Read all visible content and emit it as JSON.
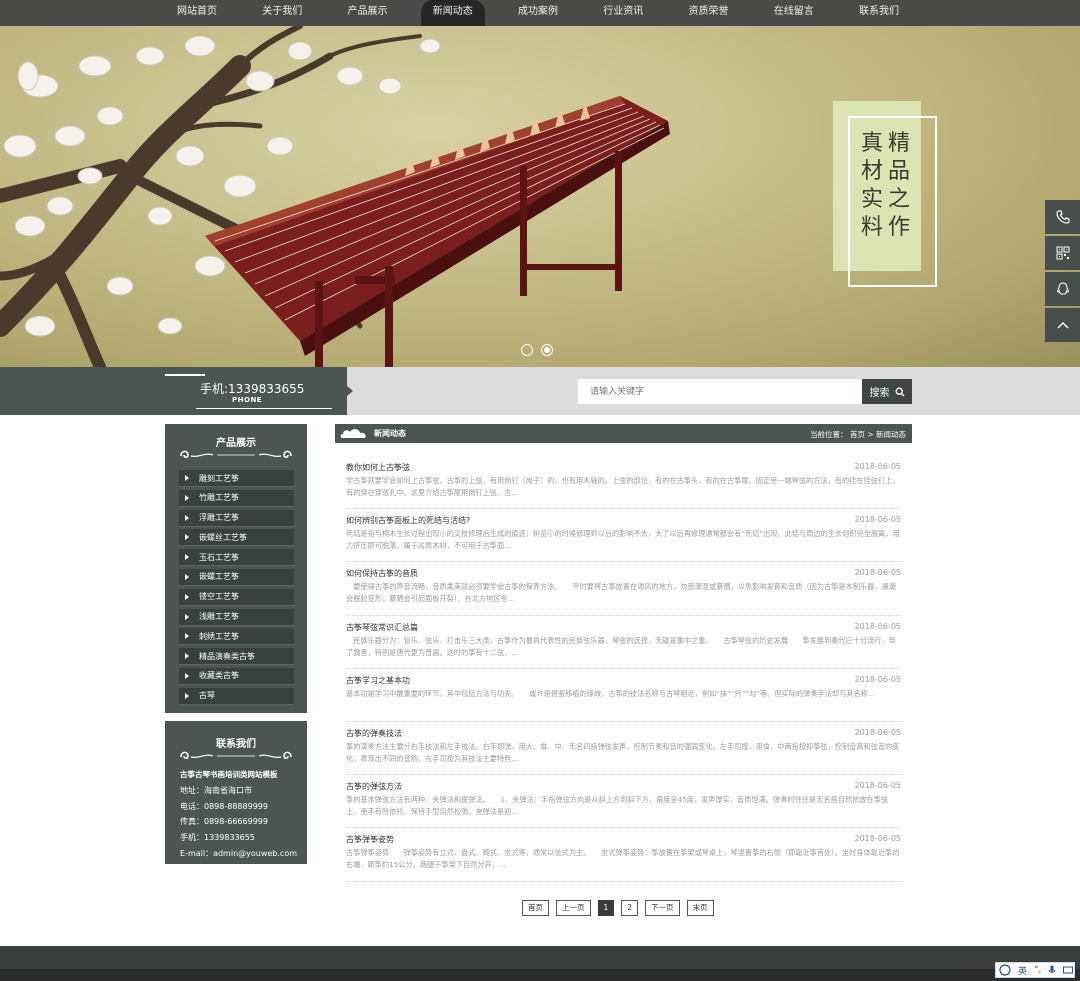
{
  "nav": {
    "items": [
      "网站首页",
      "关于我们",
      "产品展示",
      "新闻动态",
      "成功案例",
      "行业资讯",
      "资质荣誉",
      "在线留言",
      "联系我们"
    ],
    "active_index": 3
  },
  "banner": {
    "slogan_right": "精品之作",
    "slogan_left": "真材实料",
    "col_right": [
      "精",
      "品",
      "之",
      "作"
    ],
    "col_left": [
      "真",
      "材",
      "实",
      "料"
    ],
    "slide_count": 2,
    "active_slide": 2
  },
  "side_tools": [
    "phone-icon",
    "qrcode-icon",
    "qq-icon",
    "back-to-top-icon"
  ],
  "phone": {
    "text": "手机:1339833655",
    "sub": "PHONE"
  },
  "search": {
    "placeholder": "请输入关键字",
    "button": "搜索"
  },
  "sidebar": {
    "title": "产品展示",
    "categories": [
      "雕刻工艺筝",
      "竹雕工艺筝",
      "浮雕工艺筝",
      "嵌螺丝工艺筝",
      "玉石工艺筝",
      "嵌螺工艺筝",
      "镂空工艺筝",
      "浅雕工艺筝",
      "刺绣工艺筝",
      "精品演奏类古筝",
      "收藏类古筝",
      "古琴"
    ]
  },
  "contact": {
    "title": "联系我们",
    "company": "古筝古琴书画培训类网站模板",
    "address": "地址：海南省海口市",
    "tel": "电话：0898-88889999",
    "fax": "传真：0898-66669999",
    "mobile": "手机：1339833655",
    "email": "E-mail：admin@youweb.com"
  },
  "content": {
    "section_title": "新闻动态",
    "breadcrumb": "当前位置： 首页 > 新闻动态",
    "articles": [
      {
        "title": "教你如何上古筝弦",
        "date": "2018-06-05",
        "summary": "学古筝就要学会如何上古筝弦，古筝的上弦，有用岗钉（岗子）的，也有用木轴的。上弦的部位，有的在古筝头，有的在古筝尾。固定另一端琴弦的方法，有的挂在挂弦钉上，有的穿在穿弦孔中。这里介绍古筝尾用岗钉上弦，古..."
      },
      {
        "title": "如何辨别古筝面板上的死结与活结?",
        "date": "2018-06-05",
        "summary": "死结是指与桐木生长过程出现小的叉枝修理后生成的痕迹；树苗小的时候修理到以后的影响不大，大了以后再修理通常都会有“死结”出现。此结与周边的生长组织完全脱离，用力挤压即可脱落，属于劣质木材，不可用于古筝面..."
      },
      {
        "title": "如何保持古筝的音质",
        "date": "2018-06-05",
        "summary": "　要使得古筝的声音流畅，音质柔美就必须要学会古筝的保养方法。　　平时要将古筝放置在通风的地方，勿受潮湿或暴晒，以免影响发育和音质（因为古筝是木制乐器，遇潮会脱胶变形；暴晒会引起面板开裂），在北方地区冬..."
      },
      {
        "title": "古筝琴弦常识汇总篇",
        "date": "2018-06-05",
        "summary": "　民族乐器分为：管乐、弦乐、打击乐三大类，古筝作为最具代表性的民族弦乐器，琴弦的选择，无疑是重中之重。　　古筝琴弦的历史发展　　筝发展到秦代已十分流行，到了魏晋，特别是唐代更为普遍。这时的筝有十二弦，..."
      },
      {
        "title": "古筝学习之基本功",
        "date": "2018-06-05",
        "summary": "基本功是学习中最重要的环节，其中包括方法与功夫。　　或许是借鉴移植的缘故，古筝的技法名称与古琴相近，例如“抹”“托”“勾”等。但实际的弹奏手法却与其名称..."
      },
      {
        "title": "古筝的弹奏技法",
        "date": "2018-06-05",
        "summary": "筝的演奏方法主要分右手技法和左手技法。右手即弹，用大、食、中、无名四指弹弦发声，控制节奏和音的强弱变化。左手司按，用食、中两指按抑筝弦，控制音高和弦音的变化，表现出不同的音韵，左手司按为其技法主要特色..."
      },
      {
        "title": "古筝的弹弦方法",
        "date": "2018-06-05",
        "summary": "筝的基本弹弦方法有两种：夹弹法和提弹法。　　1、夹弹法：手指弹弦方向是从斜上方到斜下方，角度呈45度，发声厚实，音质饱满。弹奏时往往是无名指自然依放在筝弦上，使手有所依托，保持手型自然松弛。夹弹法是初..."
      },
      {
        "title": "古筝弹筝姿势",
        "date": "2018-06-05",
        "summary": "古筝弹筝姿势　　弹筝姿势有立式、盘式、跪式、坐式等，通常以坐式为主。　　坐式弹筝姿势：筝放置在筝架或琴桌上，琴竖置筝的右侧（即靠近筝首处）。坐时身体靠近筝的右端，距筝约15公分。两腿于筝架下自然分开，..."
      }
    ]
  },
  "pager": {
    "items": [
      "首页",
      "上一页",
      "1",
      "2",
      "下一页",
      "末页"
    ],
    "current": "1"
  },
  "ime": {
    "lang": "英"
  },
  "colors": {
    "nav_bg": "#4a4a48",
    "panel_bg": "#4d5553",
    "slogan_bg": "#dde4b4"
  }
}
